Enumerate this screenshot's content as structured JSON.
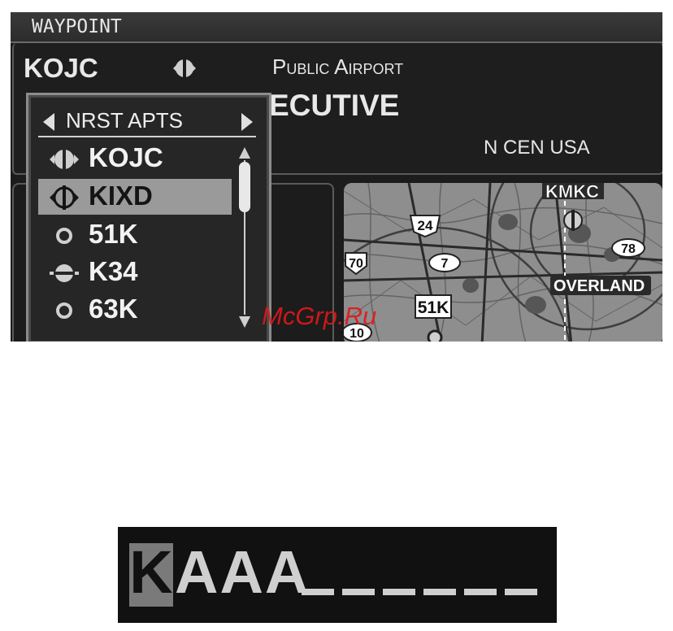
{
  "waypoint_page": {
    "title": "WAYPOINT",
    "ident": "KOJC",
    "airport_type": "Public Airport",
    "airport_name_visible": "ECUTIVE",
    "region": "N CEN USA"
  },
  "nearest_popup": {
    "title": "NRST APTS",
    "items": [
      {
        "ident": "KOJC",
        "icon": "towered-airport-icon",
        "selected": false
      },
      {
        "ident": "KIXD",
        "icon": "towered-airport-icon",
        "selected": true
      },
      {
        "ident": "51K",
        "icon": "soft-surface-airport-icon",
        "selected": false
      },
      {
        "ident": "K34",
        "icon": "non-towered-airport-icon",
        "selected": false
      },
      {
        "ident": "63K",
        "icon": "soft-surface-airport-icon",
        "selected": false
      }
    ]
  },
  "map": {
    "labels": {
      "kmkc": "KMKC",
      "overland": "OVERLAND",
      "k51": "51K",
      "hwy24": "24",
      "hwy70": "70",
      "hwy7": "7",
      "hwy78": "78",
      "hwy10": "10"
    }
  },
  "entry_field": {
    "cursor_char": "K",
    "typed": "AAA",
    "blank_count": 6
  },
  "watermark": "McGrp.Ru",
  "colors": {
    "screen_bg": "#1c1c1c",
    "selected_row": "#9a9a9a",
    "watermark": "#e01818"
  }
}
